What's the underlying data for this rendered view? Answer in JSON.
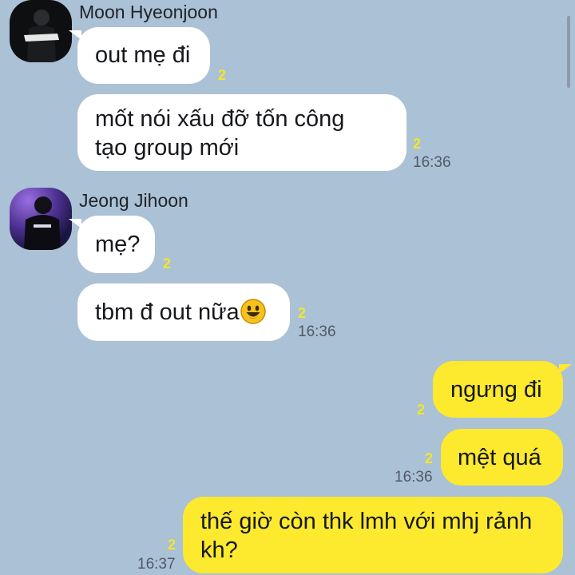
{
  "conversation": {
    "groups": [
      {
        "sender": "Moon Hyeonjoon",
        "messages": [
          {
            "lines": [
              "out mẹ đi"
            ],
            "unread": "2",
            "time": ""
          },
          {
            "lines": [
              "mốt nói xấu đỡ tốn công",
              "tạo group mới"
            ],
            "unread": "2",
            "time": "16:36"
          }
        ]
      },
      {
        "sender": "Jeong Jihoon",
        "messages": [
          {
            "lines": [
              "mẹ?"
            ],
            "unread": "2",
            "time": ""
          },
          {
            "lines": [
              "tbm đ out nữa"
            ],
            "emoji": "smiling-face-emoji",
            "unread": "2",
            "time": "16:36"
          }
        ]
      },
      {
        "sender": "me",
        "messages": [
          {
            "lines": [
              "ngưng đi"
            ],
            "unread": "2",
            "time": ""
          },
          {
            "lines": [
              "mệt quá"
            ],
            "unread": "2",
            "time": "16:36"
          },
          {
            "lines": [
              "thế giờ còn thk lmh với mhj rảnh",
              "kh?"
            ],
            "unread": "2",
            "time": "16:37"
          }
        ]
      }
    ]
  },
  "colors": {
    "background": "#abc1d6",
    "incoming_bubble": "#ffffff",
    "outgoing_bubble": "#fde92e",
    "unread_count": "#f3e52c",
    "timestamp": "#50596a"
  }
}
